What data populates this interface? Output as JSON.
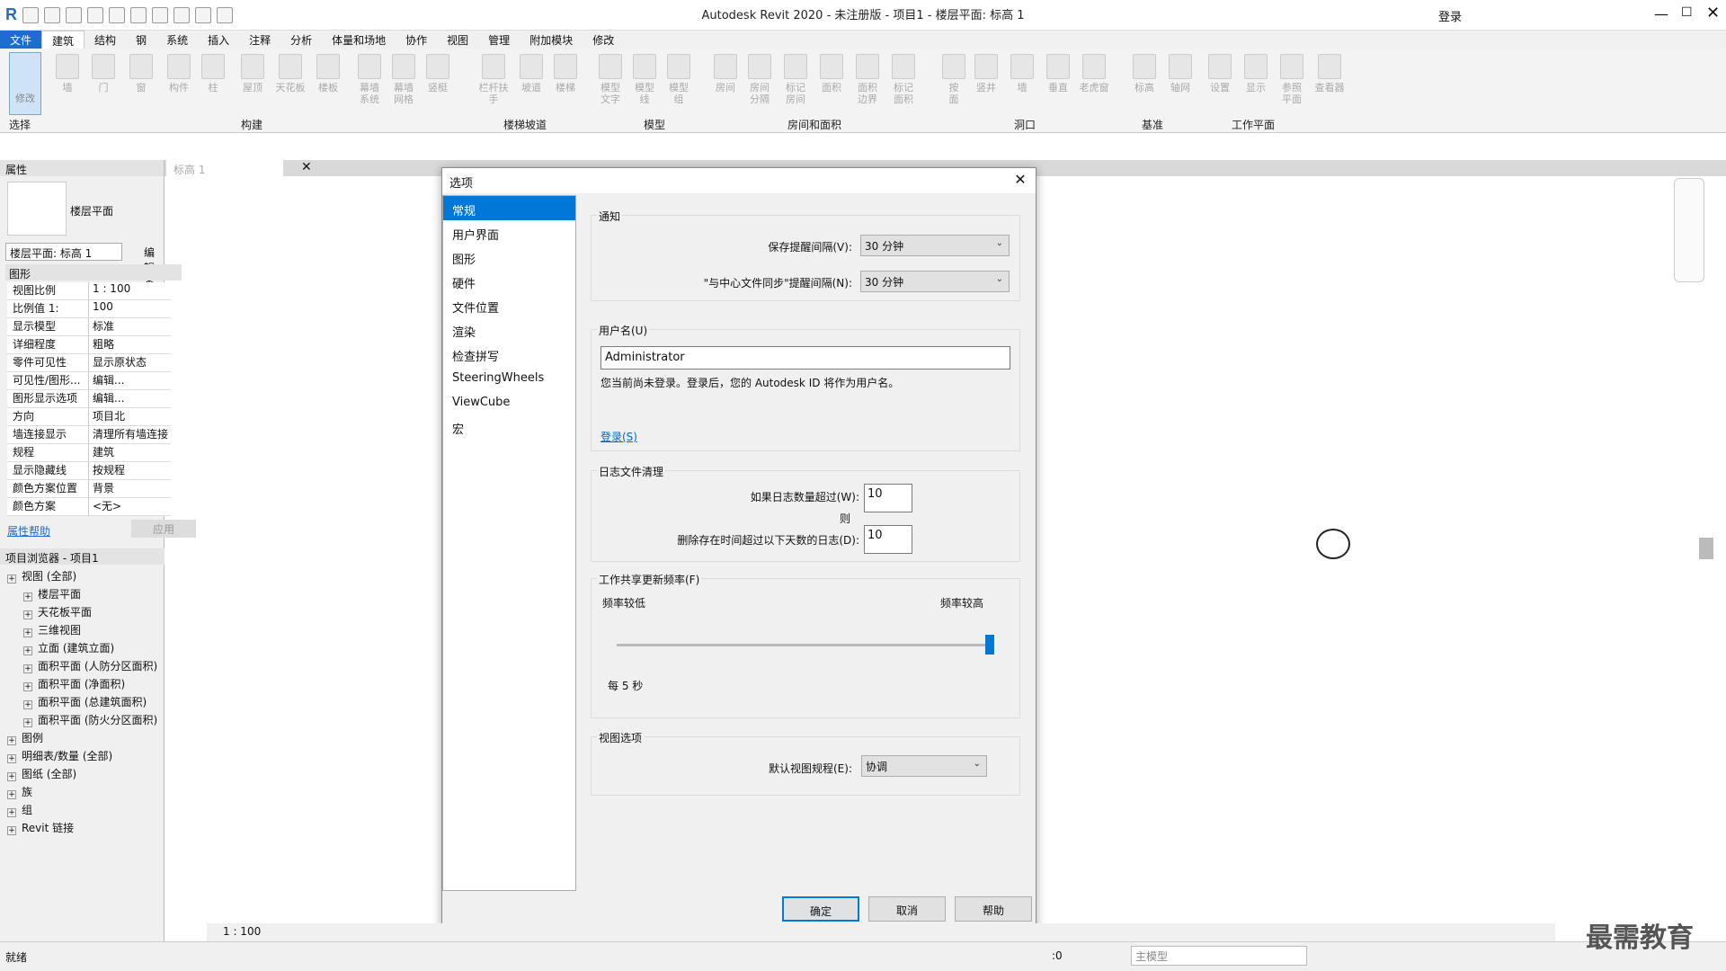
{
  "app": {
    "title": "Autodesk Revit 2020 - 未注册版 - 项目1 - 楼层平面: 标高 1",
    "login": "登录"
  },
  "menu": [
    "文件",
    "建筑",
    "结构",
    "钢",
    "系统",
    "插入",
    "注释",
    "分析",
    "体量和场地",
    "协作",
    "视图",
    "管理",
    "附加模块",
    "修改"
  ],
  "ribbon": {
    "select_label": "修改",
    "select_group": "选择",
    "buttons": [
      "墙",
      "门",
      "窗",
      "构件",
      "柱",
      "屋顶",
      "天花板",
      "楼板",
      "幕墙",
      "幕墙",
      "竖梃",
      "栏杆扶手",
      "坡道",
      "楼梯",
      "模型",
      "模型",
      "模型",
      "房间",
      "房间",
      "标记",
      "面积",
      "面积",
      "标记",
      "按",
      "竖井",
      "墙",
      "垂直",
      "老虎窗",
      "标高",
      "轴网",
      "设置",
      "显示",
      "参照",
      "查看器"
    ],
    "buttons2": [
      "",
      "",
      "",
      "",
      "",
      "",
      "",
      "",
      "系统",
      "网格",
      "",
      "",
      "",
      "",
      "文字",
      "线",
      "组",
      "",
      "分隔",
      "房间",
      "",
      "边界",
      "面积",
      "面",
      "",
      "",
      "",
      "",
      "",
      "",
      "",
      "",
      "平面",
      ""
    ],
    "groups": [
      "构建",
      "楼梯坡道",
      "模型",
      "房间和面积",
      "洞口",
      "基准",
      "工作平面"
    ]
  },
  "properties": {
    "header": "属性",
    "type_name": "楼层平面",
    "view_selector": "楼层平面: 标高 1",
    "edit_type": "编辑类型",
    "section": "图形",
    "rows": [
      {
        "k": "视图比例",
        "v": "1 : 100"
      },
      {
        "k": "比例值 1:",
        "v": "100"
      },
      {
        "k": "显示模型",
        "v": "标准"
      },
      {
        "k": "详细程度",
        "v": "粗略"
      },
      {
        "k": "零件可见性",
        "v": "显示原状态"
      },
      {
        "k": "可见性/图形...",
        "v": "编辑..."
      },
      {
        "k": "图形显示选项",
        "v": "编辑..."
      },
      {
        "k": "方向",
        "v": "项目北"
      },
      {
        "k": "墙连接显示",
        "v": "清理所有墙连接"
      },
      {
        "k": "规程",
        "v": "建筑"
      },
      {
        "k": "显示隐藏线",
        "v": "按规程"
      },
      {
        "k": "颜色方案位置",
        "v": "背景"
      },
      {
        "k": "颜色方案",
        "v": "<无>"
      }
    ],
    "help": "属性帮助",
    "apply": "应用"
  },
  "browser": {
    "header": "项目浏览器 - 项目1",
    "items": [
      "视图 (全部)",
      "楼层平面",
      "天花板平面",
      "三维视图",
      "立面 (建筑立面)",
      "面积平面 (人防分区面积)",
      "面积平面 (净面积)",
      "面积平面 (总建筑面积)",
      "面积平面 (防火分区面积)",
      "图例",
      "明细表/数量 (全部)",
      "图纸 (全部)",
      "族",
      "组",
      "Revit 链接"
    ]
  },
  "view_tab": "标高 1",
  "dialog": {
    "title": "选项",
    "nav": [
      "常规",
      "用户界面",
      "图形",
      "硬件",
      "文件位置",
      "渲染",
      "检查拼写",
      "SteeringWheels",
      "ViewCube",
      "宏"
    ],
    "notify": {
      "title": "通知",
      "save_label": "保存提醒间隔(V):",
      "save_value": "30 分钟",
      "sync_label": "\"与中心文件同步\"提醒间隔(N):",
      "sync_value": "30 分钟"
    },
    "user": {
      "title": "用户名(U)",
      "value": "Administrator",
      "note": "您当前尚未登录。登录后，您的 Autodesk ID 将作为用户名。",
      "login_link": "登录(S)"
    },
    "journal": {
      "title": "日志文件清理",
      "count_label": "如果日志数量超过(W):",
      "count_value": "10",
      "then": "则",
      "days_label": "删除存在时间超过以下天数的日志(D):",
      "days_value": "10"
    },
    "worksharing": {
      "title": "工作共享更新频率(F)",
      "low": "频率较低",
      "high": "频率较高",
      "value": "每 5 秒",
      "slider_fraction": 1.0
    },
    "view_opts": {
      "title": "视图选项",
      "discipline_label": "默认视图规程(E):",
      "discipline_value": "协调"
    },
    "ok": "确定",
    "cancel": "取消",
    "help": "帮助"
  },
  "status": {
    "ready": "就绪",
    "scale": "1 : 100",
    "zero": ":0",
    "model": "主模型"
  },
  "watermark": "最需教育"
}
